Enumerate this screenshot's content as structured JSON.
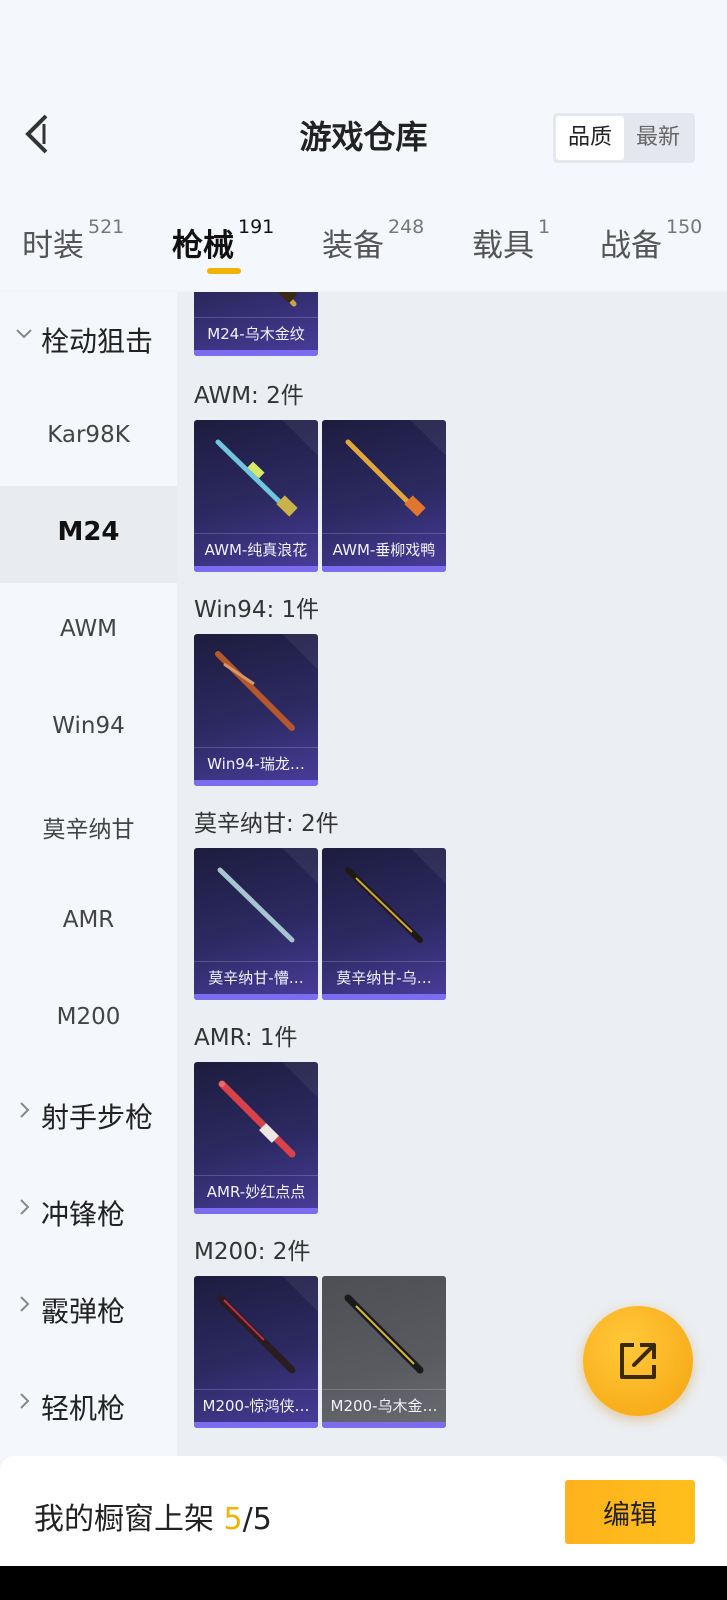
{
  "header": {
    "title": "游戏仓库",
    "sort_options": [
      "品质",
      "最新"
    ],
    "back_icon": "chevron-left-icon"
  },
  "tabs": [
    {
      "label": "时装",
      "count": "521"
    },
    {
      "label": "枪械",
      "count": "191",
      "active": true
    },
    {
      "label": "装备",
      "count": "248"
    },
    {
      "label": "载具",
      "count": "1"
    },
    {
      "label": "战备",
      "count": "150"
    }
  ],
  "sidebar": {
    "categories": [
      {
        "label": "栓动狙击",
        "expanded": true
      },
      {
        "label": "Kar98K"
      },
      {
        "label": "M24",
        "selected": true
      },
      {
        "label": "AWM"
      },
      {
        "label": "Win94"
      },
      {
        "label": "莫辛纳甘"
      },
      {
        "label": "AMR"
      },
      {
        "label": "M200"
      },
      {
        "label": "射手步枪"
      },
      {
        "label": "冲锋枪"
      },
      {
        "label": "霰弹枪"
      },
      {
        "label": "轻机枪"
      }
    ]
  },
  "groups": [
    {
      "title": "",
      "items": [
        {
          "name": "M24-乌木金纹"
        }
      ]
    },
    {
      "title": "AWM: 2件",
      "items": [
        {
          "name": "AWM-纯真浪花"
        },
        {
          "name": "AWM-垂柳戏鸭"
        }
      ]
    },
    {
      "title": "Win94: 1件",
      "items": [
        {
          "name": "Win94-瑞龙…"
        }
      ]
    },
    {
      "title": "莫辛纳甘: 2件",
      "items": [
        {
          "name": "莫辛纳甘-懵…"
        },
        {
          "name": "莫辛纳甘-乌…"
        }
      ]
    },
    {
      "title": "AMR: 1件",
      "items": [
        {
          "name": "AMR-妙红点点"
        }
      ]
    },
    {
      "title": "M200: 2件",
      "items": [
        {
          "name": "M200-惊鸿侠…"
        },
        {
          "name": "M200-乌木金…"
        }
      ]
    }
  ],
  "fab": {
    "icon": "share-external-icon"
  },
  "footer": {
    "shelf_label": "我的橱窗上架",
    "shelf_current": "5",
    "shelf_sep": "/",
    "shelf_total": "5",
    "edit_label": "编辑"
  },
  "colors": {
    "accent": "#f5b301",
    "card_bg": "#2d2a63",
    "card_bar": "#7b6cf0"
  }
}
